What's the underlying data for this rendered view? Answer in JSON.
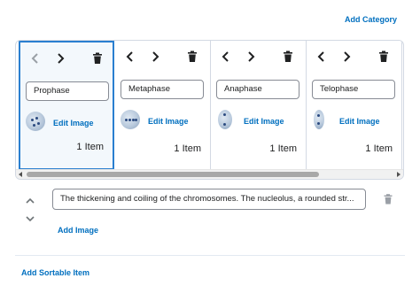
{
  "header": {
    "add_category_label": "Add Category"
  },
  "categories": [
    {
      "name": "Prophase",
      "edit_image_label": "Edit Image",
      "count_label": "1 Item",
      "selected": true,
      "prev_enabled": false
    },
    {
      "name": "Metaphase",
      "edit_image_label": "Edit Image",
      "count_label": "1 Item",
      "selected": false,
      "prev_enabled": true
    },
    {
      "name": "Anaphase",
      "edit_image_label": "Edit Image",
      "count_label": "1 Item",
      "selected": false,
      "prev_enabled": true
    },
    {
      "name": "Telophase",
      "edit_image_label": "Edit Image",
      "count_label": "1 Item",
      "selected": false,
      "prev_enabled": true
    }
  ],
  "icons": {
    "prev": "chevron-left-icon",
    "next": "chevron-right-icon",
    "delete": "trash-icon",
    "up": "chevron-up-icon",
    "down": "chevron-down-icon"
  },
  "colors": {
    "accent": "#006fbf",
    "selected_border": "#2a7fd0",
    "selected_bg": "#f3f8fc",
    "border": "#d3d9e3",
    "icon": "#202122",
    "icon_disabled": "#9aa0a6",
    "trash_muted": "#9a9fa6"
  },
  "item": {
    "text": "The thickening and coiling of the chromosomes. The nucleolus, a rounded str...",
    "add_image_label": "Add Image"
  },
  "footer": {
    "add_sortable_label": "Add Sortable Item"
  }
}
